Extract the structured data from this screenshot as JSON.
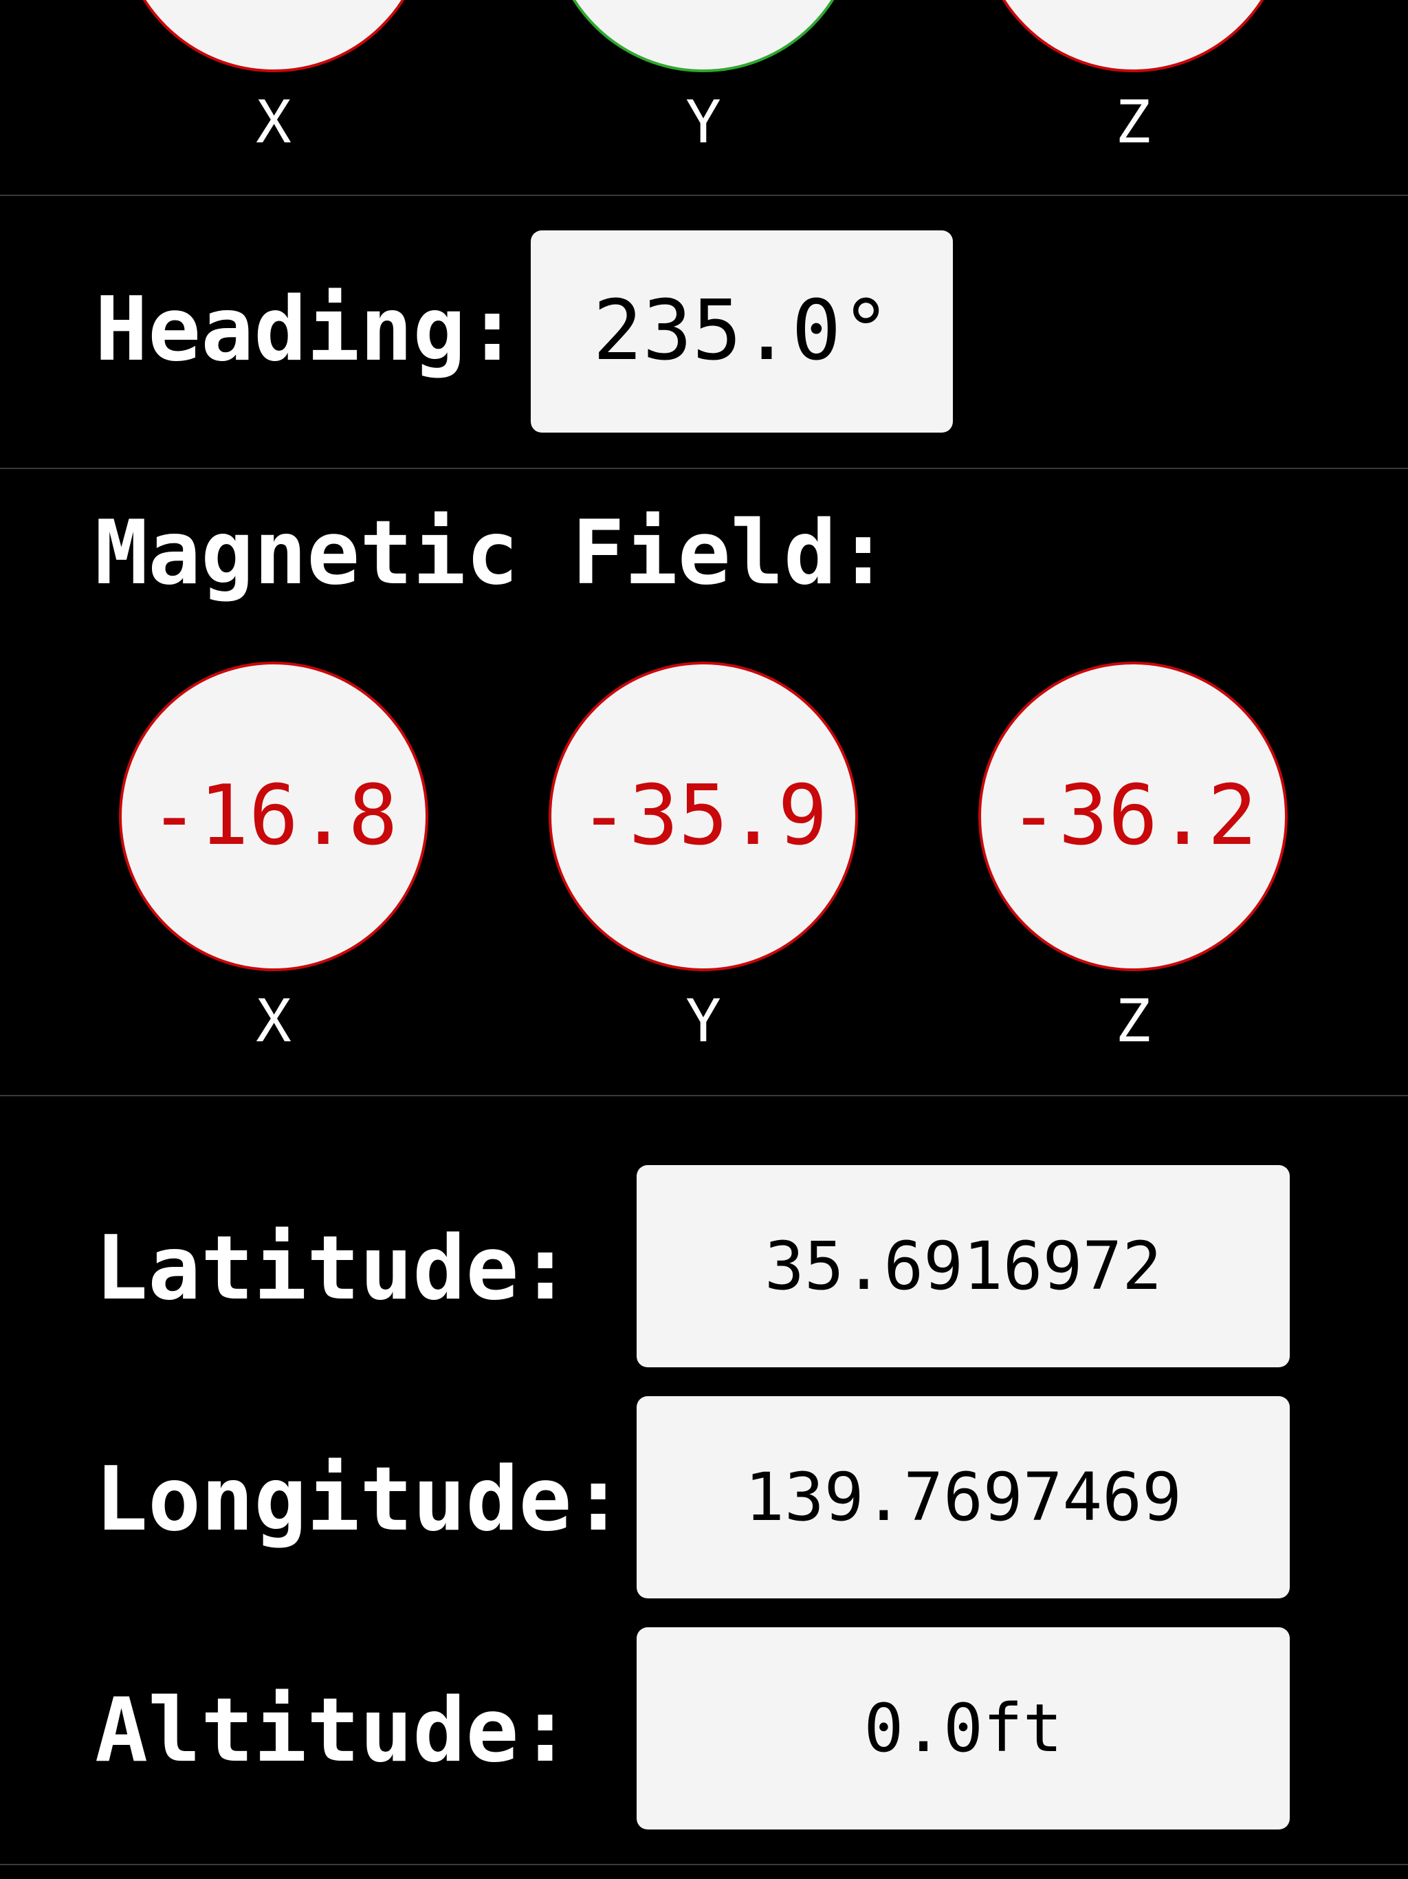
{
  "top_axes": {
    "labels": [
      "X",
      "Y",
      "Z"
    ],
    "ring_colors": [
      "#c8080a",
      "#2fa82f",
      "#c8080a"
    ]
  },
  "heading": {
    "label": "Heading:",
    "value": "235.0°"
  },
  "magnetic_field": {
    "title": "Magnetic Field:",
    "axes": [
      {
        "axis": "X",
        "value": "-16.8"
      },
      {
        "axis": "Y",
        "value": "-35.9"
      },
      {
        "axis": "Z",
        "value": "-36.2"
      }
    ],
    "value_color": "#c8080a"
  },
  "location": {
    "latitude_label": "Latitude:",
    "latitude_value": "35.6916972",
    "longitude_label": "Longitude:",
    "longitude_value": "139.7697469",
    "altitude_label": "Altitude:",
    "altitude_value": "0.0ft"
  },
  "colors": {
    "background": "#000000",
    "panel": "#f4f4f4",
    "alert_red": "#c8080a",
    "ok_green": "#2fa82f"
  }
}
